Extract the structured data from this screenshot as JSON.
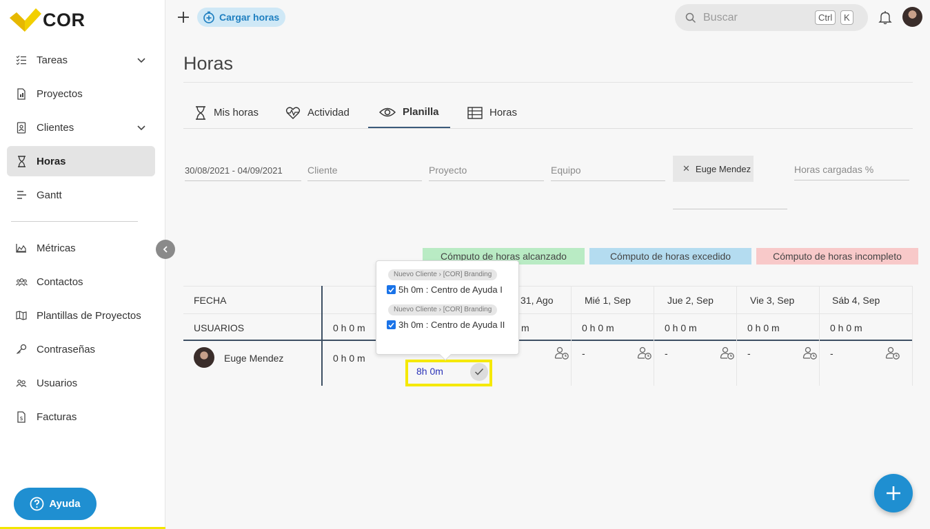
{
  "brand": {
    "name": "COR",
    "logo_color": "#f2d000"
  },
  "sidebar": {
    "items": [
      {
        "label": "Tareas",
        "icon": "task-list-icon",
        "has_chevron": true
      },
      {
        "label": "Proyectos",
        "icon": "document-icon"
      },
      {
        "label": "Clientes",
        "icon": "contact-card-icon",
        "has_chevron": true
      },
      {
        "label": "Horas",
        "icon": "hourglass-icon",
        "active": true
      },
      {
        "label": "Gantt",
        "icon": "gantt-icon"
      },
      {
        "label": "Métricas",
        "icon": "area-chart-icon"
      },
      {
        "label": "Contactos",
        "icon": "people-icon"
      },
      {
        "label": "Plantillas de Proyectos",
        "icon": "map-icon"
      },
      {
        "label": "Contraseñas",
        "icon": "key-icon"
      },
      {
        "label": "Usuarios",
        "icon": "users-icon"
      },
      {
        "label": "Facturas",
        "icon": "invoice-icon"
      }
    ],
    "help_label": "Ayuda"
  },
  "topbar": {
    "cargar_label": "Cargar horas",
    "search_placeholder": "Buscar",
    "kbd_ctrl": "Ctrl",
    "kbd_k": "K"
  },
  "page": {
    "title": "Horas",
    "tabs": [
      {
        "label": "Mis horas",
        "icon": "hourglass-icon"
      },
      {
        "label": "Actividad",
        "icon": "heart-pulse-icon"
      },
      {
        "label": "Planilla",
        "icon": "eye-icon",
        "active": true
      },
      {
        "label": "Horas",
        "icon": "table-icon"
      }
    ]
  },
  "filters": {
    "date_range": "30/08/2021 - 04/09/2021",
    "cliente": "Cliente",
    "proyecto": "Proyecto",
    "equipo": "Equipo",
    "chip_user": "Euge Mendez",
    "horas_cargadas": "Horas cargadas %"
  },
  "legend": {
    "alcanzado": {
      "label": "Cómputo de horas alcanzado",
      "color": "#b9ebc4"
    },
    "excedido": {
      "label": "Cómputo de horas excedido",
      "color": "#b4dcf0"
    },
    "incompleto": {
      "label": "Cómputo de horas incompleto",
      "color": "#f8c9c9"
    }
  },
  "table": {
    "fecha_label": "FECHA",
    "usuarios_label": "USUARIOS",
    "day_headers": [
      "",
      "31, Ago",
      "Mié 1, Sep",
      "Jue 2, Sep",
      "Vie 3, Sep",
      "Sáb 4, Sep"
    ],
    "totals": [
      "0 h 0 m",
      "m",
      "0 h 0 m",
      "0 h 0 m",
      "0 h 0 m",
      "0 h 0 m"
    ],
    "row": {
      "user_name": "Euge Mendez",
      "total": "0 h 0 m",
      "cells": [
        "-",
        "-",
        "-",
        "-"
      ]
    },
    "highlight_value": "8h 0m"
  },
  "popover": {
    "entries": [
      {
        "tag": "Nuevo Cliente › [COR] Branding",
        "text": "5h 0m : Centro de Ayuda I",
        "checked": true
      },
      {
        "tag": "Nuevo Cliente › [COR] Branding",
        "text": "3h 0m : Centro de Ayuda II",
        "checked": true
      }
    ]
  }
}
